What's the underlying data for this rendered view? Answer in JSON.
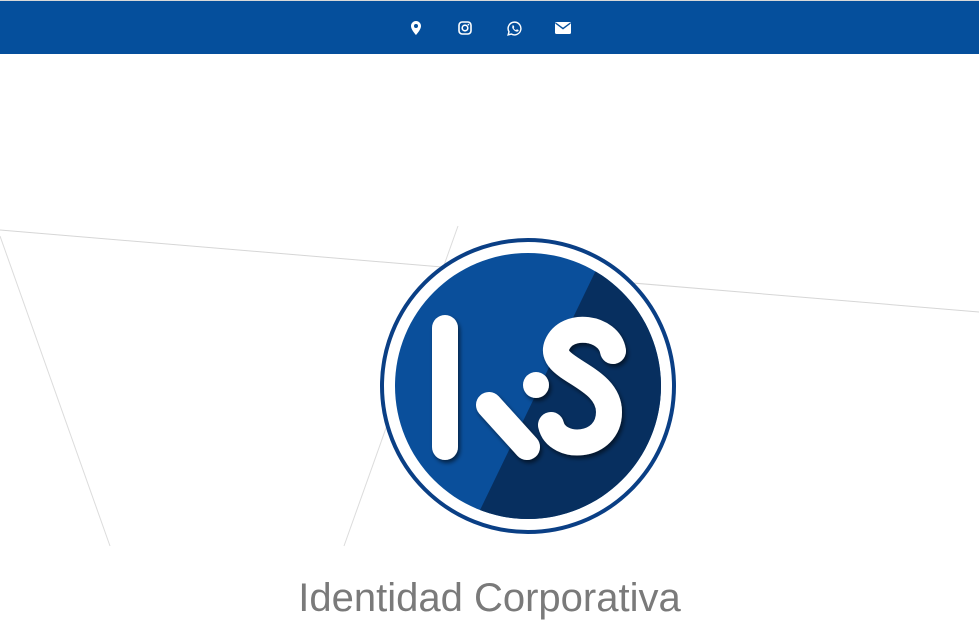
{
  "header": {
    "background_color": "#054f9c",
    "social_icons": [
      {
        "icon": "map-marker-icon"
      },
      {
        "icon": "instagram-icon"
      },
      {
        "icon": "whatsapp-icon"
      },
      {
        "icon": "envelope-icon"
      }
    ]
  },
  "logo": {
    "text_k": "K",
    "text_s": "S",
    "ring_color": "#0a3f85",
    "light_blue": "#0a4f9b",
    "dark_blue": "#072f5f"
  },
  "main": {
    "title": "Identidad Corporativa"
  },
  "colors": {
    "title_text": "#7a7a7a",
    "background": "#ffffff"
  }
}
